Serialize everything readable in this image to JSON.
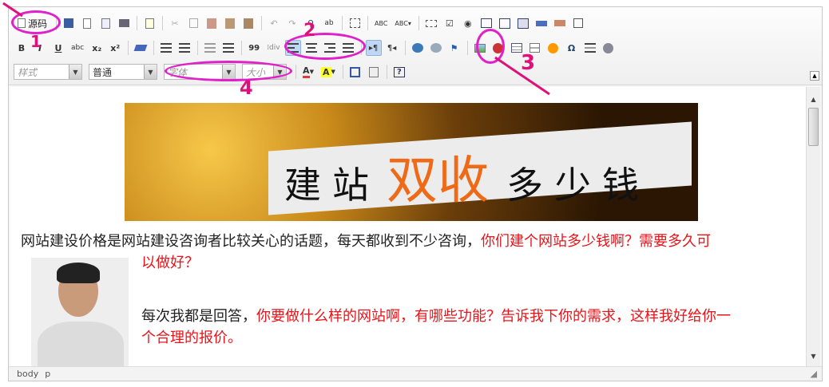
{
  "toolbar": {
    "source_label": "源码",
    "style_combo": "样式",
    "format_combo": "普通",
    "font_combo": "字体",
    "size_combo": "大小",
    "row1_icons": [
      "save-icon",
      "new-page-icon",
      "preview-icon",
      "print-icon",
      "templates-icon",
      "cut-icon",
      "copy-icon",
      "paste-icon",
      "paste-text-icon",
      "paste-word-icon",
      "undo-icon",
      "redo-icon",
      "find-icon",
      "replace-icon",
      "select-all-icon",
      "spellcheck-icon",
      "scayt-icon",
      "form-icon",
      "checkbox-icon",
      "radio-icon",
      "textfield-icon",
      "textarea-icon",
      "select-icon",
      "button-icon",
      "image-button-icon",
      "hidden-field-icon"
    ],
    "row2_icons": [
      "bold-icon",
      "italic-icon",
      "underline-icon",
      "strike-icon",
      "subscript-icon",
      "superscript-icon",
      "remove-format-icon",
      "numbered-list-icon",
      "bullet-list-icon",
      "outdent-icon",
      "indent-icon",
      "blockquote-icon",
      "div-icon",
      "align-left-icon",
      "align-center-icon",
      "align-right-icon",
      "align-justify-icon",
      "ltr-icon",
      "rtl-icon",
      "link-icon",
      "unlink-icon",
      "anchor-icon",
      "image-icon",
      "flash-icon",
      "table-icon",
      "horizontal-rule-icon",
      "smiley-icon",
      "special-char-icon",
      "page-break-icon",
      "iframe-icon"
    ],
    "row3_icons": [
      "text-color-icon",
      "bg-color-icon",
      "maximize-icon",
      "show-blocks-icon",
      "about-icon"
    ],
    "glyphs": {
      "bold": "B",
      "italic": "I",
      "underline": "U",
      "strike": "abc",
      "sub": "x₂",
      "sup": "x²",
      "blockquote": "99",
      "special": "Ω",
      "about": "?",
      "text_color": "A",
      "bg_color": "A"
    }
  },
  "content": {
    "banner": {
      "w1": "建站",
      "w2": "双收",
      "w3": "多少钱"
    },
    "p1_black": "网站建设价格是网站建设咨询者比较关心的话题，每天都收到不少咨询，",
    "p1_red": "你们建个网站多少钱啊？需要多久可",
    "p1_red2": "以做好？",
    "p2_black": "每次我都是回答，",
    "p2_red": "你要做什么样的网站啊，有哪些功能？告诉我下你的需求，这样我好给你一",
    "p2_red2": "个合理的报价。"
  },
  "statusbar": {
    "path1": "body",
    "path2": "p"
  },
  "annotations": {
    "n1": "1",
    "n2": "2",
    "n3": "3",
    "n4": "4"
  },
  "colors": {
    "accent_red": "#e8141a",
    "annotation": "#e020c8",
    "banner_orange": "#ee6a16"
  }
}
